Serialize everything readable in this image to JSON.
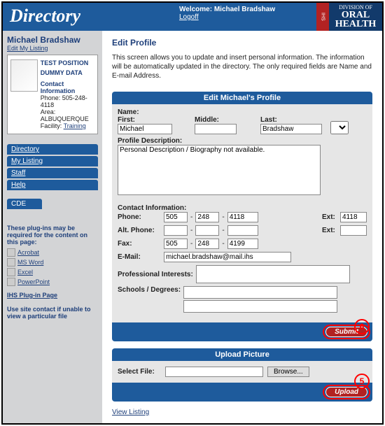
{
  "header": {
    "brand": "Directory",
    "welcome_prefix": "Welcome: ",
    "welcome_name": "Michael Bradshaw",
    "logoff": "Logoff",
    "logo_division": "DIVISION OF",
    "logo_line1": "ORAL",
    "logo_line2": "HEALTH",
    "logo_ihs": "IHS"
  },
  "sidebar": {
    "profile_name": "Michael Bradshaw",
    "edit_link": "Edit My Listing",
    "card": {
      "position_1": "TEST POSITION",
      "position_2": "DUMMY DATA",
      "ci_label": "Contact Information",
      "phone_label": "Phone:",
      "phone": "505-248-4118",
      "area_label": "Area:",
      "area": "ALBUQUERQUE",
      "facility_label": "Facility:",
      "facility": "Training"
    },
    "nav": [
      "Directory",
      "My Listing",
      "Staff",
      "Help"
    ],
    "cde": "CDE",
    "plugins": {
      "heading": "These plug-ins may be required for the content on this page:",
      "items": [
        "Acrobat",
        "MS Word",
        "Excel",
        "PowerPoint"
      ],
      "page_link": "IHS Plug-in Page",
      "hint": "Use site contact if unable to view a particular file"
    }
  },
  "main": {
    "title": "Edit Profile",
    "desc": "This screen allows you to update and insert personal information. The information will be automatically updated in the directory. The only required fields are Name and E-mail Address.",
    "panel1": {
      "title": "Edit Michael's Profile",
      "name_label": "Name:",
      "first_label": "First:",
      "middle_label": "Middle:",
      "last_label": "Last:",
      "first": "Michael",
      "middle": "",
      "last": "Bradshaw",
      "profile_desc_label": "Profile Description:",
      "profile_desc": "Personal Description / Biography not available.",
      "ci_label": "Contact Information:",
      "phone_label": "Phone:",
      "alt_phone_label": "Alt. Phone:",
      "fax_label": "Fax:",
      "email_label": "E-Mail:",
      "ext_label": "Ext:",
      "phone": {
        "a": "505",
        "b": "248",
        "c": "4118",
        "ext": "4118"
      },
      "alt": {
        "a": "",
        "b": "",
        "c": "",
        "ext": ""
      },
      "fax": {
        "a": "505",
        "b": "248",
        "c": "4199"
      },
      "email": "michael.bradshaw@mail.ihs",
      "prof_interests_label": "Professional Interests:",
      "schools_label": "Schools / Degrees:",
      "submit": "Submit"
    },
    "panel2": {
      "title": "Upload Picture",
      "select_label": "Select File:",
      "browse": "Browse...",
      "upload": "Upload"
    },
    "view_listing": "View Listing",
    "callouts": {
      "c5": "5",
      "c6": "6"
    }
  }
}
